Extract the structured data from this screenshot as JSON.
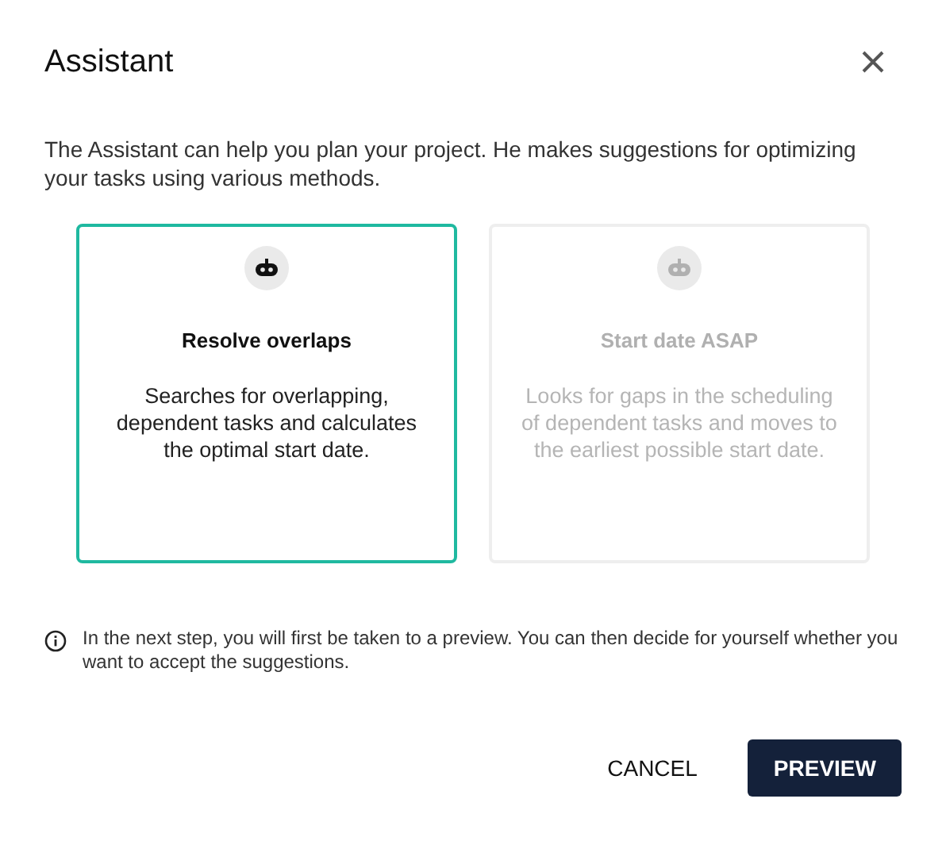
{
  "dialog": {
    "title": "Assistant",
    "intro": "The Assistant can help you plan your project. He makes suggestions for optimizing your tasks using various methods."
  },
  "options": [
    {
      "title": "Resolve overlaps",
      "description": "Searches for overlapping, dependent tasks and calculates the optimal start date.",
      "selected": true,
      "disabled": false
    },
    {
      "title": "Start date ASAP",
      "description": "Looks for gaps in the scheduling of dependent tasks and moves to the earliest possible start date.",
      "selected": false,
      "disabled": true
    }
  ],
  "info": "In the next step, you will first be taken to a preview. You can then decide for yourself whether you want to accept the suggestions.",
  "buttons": [
    {
      "label": "CANCEL",
      "kind": "text"
    },
    {
      "label": "PREVIEW",
      "kind": "primary"
    }
  ]
}
